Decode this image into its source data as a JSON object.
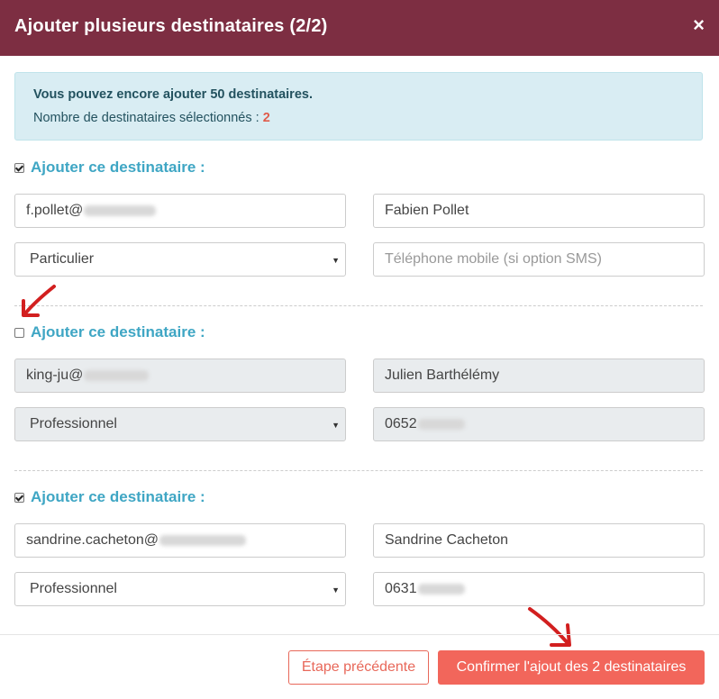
{
  "modal": {
    "title": "Ajouter plusieurs destinataires (2/2)",
    "close_icon": "×"
  },
  "alert": {
    "line1": "Vous pouvez encore ajouter 50 destinataires.",
    "line2_prefix": "Nombre de destinataires sélectionnés : ",
    "count": "2"
  },
  "recipients": [
    {
      "checked": true,
      "heading": "Ajouter ce destinataire :",
      "email_visible": "f.pollet@",
      "name": "Fabien Pollet",
      "type": "Particulier",
      "phone_placeholder": "Téléphone mobile (si option SMS)"
    },
    {
      "checked": false,
      "heading": "Ajouter ce destinataire :",
      "email_visible": "king-ju@",
      "name": "Julien Barthélémy",
      "type": "Professionnel",
      "phone_visible": "0652"
    },
    {
      "checked": true,
      "heading": "Ajouter ce destinataire :",
      "email_visible": "sandrine.cacheton@",
      "name": "Sandrine Cacheton",
      "type": "Professionnel",
      "phone_visible": "0631"
    }
  ],
  "footer": {
    "prev_label": "Étape précédente",
    "confirm_label": "Confirmer l'ajout des 2 destinataires"
  },
  "colors": {
    "header": "#7d2e42",
    "accent": "#3fa6c4",
    "button": "#f2665b",
    "annotation_arrow": "#d21f1f"
  }
}
